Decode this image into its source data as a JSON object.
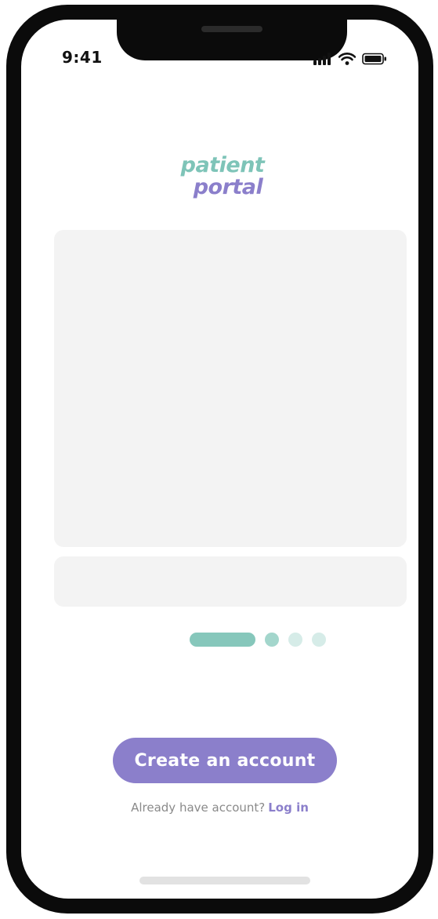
{
  "status_bar": {
    "time": "9:41",
    "icons": [
      "signal-icon",
      "wifi-icon",
      "battery-icon"
    ]
  },
  "logo": {
    "line1": "patient",
    "line2": "portal",
    "colors": {
      "line1": "#7ec4b8",
      "line2": "#8b7fcb"
    }
  },
  "onboarding": {
    "page_count": 4,
    "current_page": 1
  },
  "actions": {
    "create_account_label": "Create an account",
    "login_prompt": "Already have account?",
    "login_label": "Log in"
  },
  "colors": {
    "accent_primary": "#8b7fcb",
    "accent_secondary": "#86c7bb",
    "placeholder": "#f3f3f3"
  }
}
